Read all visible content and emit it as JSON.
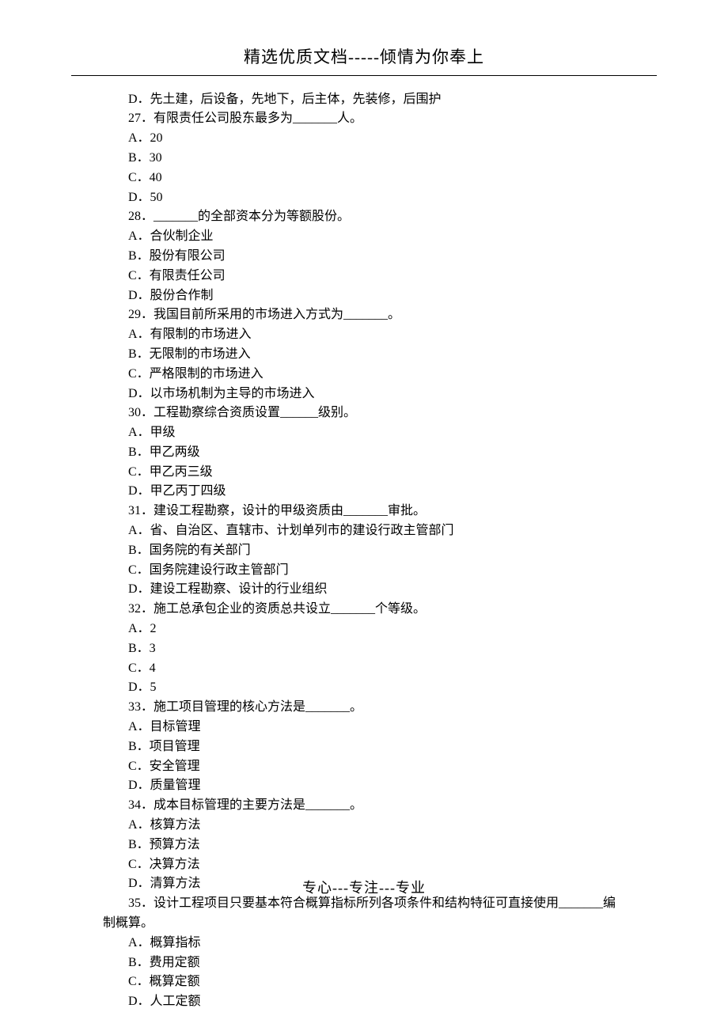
{
  "header": "精选优质文档-----倾情为你奉上",
  "footer": "专心---专注---专业",
  "lines": [
    {
      "cls": "indent",
      "text": "D．先土建，后设备，先地下，后主体，先装修，后围护"
    },
    {
      "cls": "indent",
      "text": "27．有限责任公司股东最多为_______人。"
    },
    {
      "cls": "indent",
      "text": "A．20"
    },
    {
      "cls": "indent",
      "text": "B．30"
    },
    {
      "cls": "indent",
      "text": "C．40"
    },
    {
      "cls": "indent",
      "text": "D．50"
    },
    {
      "cls": "indent",
      "text": "28．_______的全部资本分为等额股份。"
    },
    {
      "cls": "indent",
      "text": "A．合伙制企业"
    },
    {
      "cls": "indent",
      "text": "B．股份有限公司"
    },
    {
      "cls": "indent",
      "text": "C．有限责任公司"
    },
    {
      "cls": "indent",
      "text": "D．股份合作制"
    },
    {
      "cls": "indent",
      "text": "29．我国目前所采用的市场进入方式为_______。"
    },
    {
      "cls": "indent",
      "text": "A．有限制的市场进入"
    },
    {
      "cls": "indent",
      "text": "B．无限制的市场进入"
    },
    {
      "cls": "indent",
      "text": "C．严格限制的市场进入"
    },
    {
      "cls": "indent",
      "text": "D．以市场机制为主导的市场进入"
    },
    {
      "cls": "indent",
      "text": "30．工程勘察综合资质设置______级别。"
    },
    {
      "cls": "indent",
      "text": "A．甲级"
    },
    {
      "cls": "indent",
      "text": "B．甲乙两级"
    },
    {
      "cls": "indent",
      "text": "C．甲乙丙三级"
    },
    {
      "cls": "indent",
      "text": "D．甲乙丙丁四级"
    },
    {
      "cls": "indent",
      "text": "31．建设工程勘察，设计的甲级资质由_______审批。"
    },
    {
      "cls": "indent",
      "text": "A．省、自治区、直辖市、计划单列市的建设行政主管部门"
    },
    {
      "cls": "indent",
      "text": "B．国务院的有关部门"
    },
    {
      "cls": "indent",
      "text": "C．国务院建设行政主管部门"
    },
    {
      "cls": "indent",
      "text": "D．建设工程勘察、设计的行业组织"
    },
    {
      "cls": "indent",
      "text": "32．施工总承包企业的资质总共设立_______个等级。"
    },
    {
      "cls": "indent",
      "text": "A．2"
    },
    {
      "cls": "indent",
      "text": "B．3"
    },
    {
      "cls": "indent",
      "text": "C．4"
    },
    {
      "cls": "indent",
      "text": "D．5"
    },
    {
      "cls": "indent",
      "text": "33．施工项目管理的核心方法是_______。"
    },
    {
      "cls": "indent",
      "text": "A．目标管理"
    },
    {
      "cls": "indent",
      "text": "B．项目管理"
    },
    {
      "cls": "indent",
      "text": "C．安全管理"
    },
    {
      "cls": "indent",
      "text": "D．质量管理"
    },
    {
      "cls": "indent",
      "text": "34．成本目标管理的主要方法是_______。"
    },
    {
      "cls": "indent",
      "text": "A．核算方法"
    },
    {
      "cls": "indent",
      "text": "B．预算方法"
    },
    {
      "cls": "indent",
      "text": "C．决算方法"
    },
    {
      "cls": "indent",
      "text": "D．清算方法"
    },
    {
      "cls": "indent",
      "text": "35．设计工程项目只要基本符合概算指标所列各项条件和结构特征可直接使用_______编"
    },
    {
      "cls": "no-indent",
      "text": "制概算。"
    },
    {
      "cls": "indent",
      "text": "A．概算指标"
    },
    {
      "cls": "indent",
      "text": "B．费用定额"
    },
    {
      "cls": "indent",
      "text": "C．概算定额"
    },
    {
      "cls": "indent",
      "text": "D．人工定额"
    }
  ]
}
